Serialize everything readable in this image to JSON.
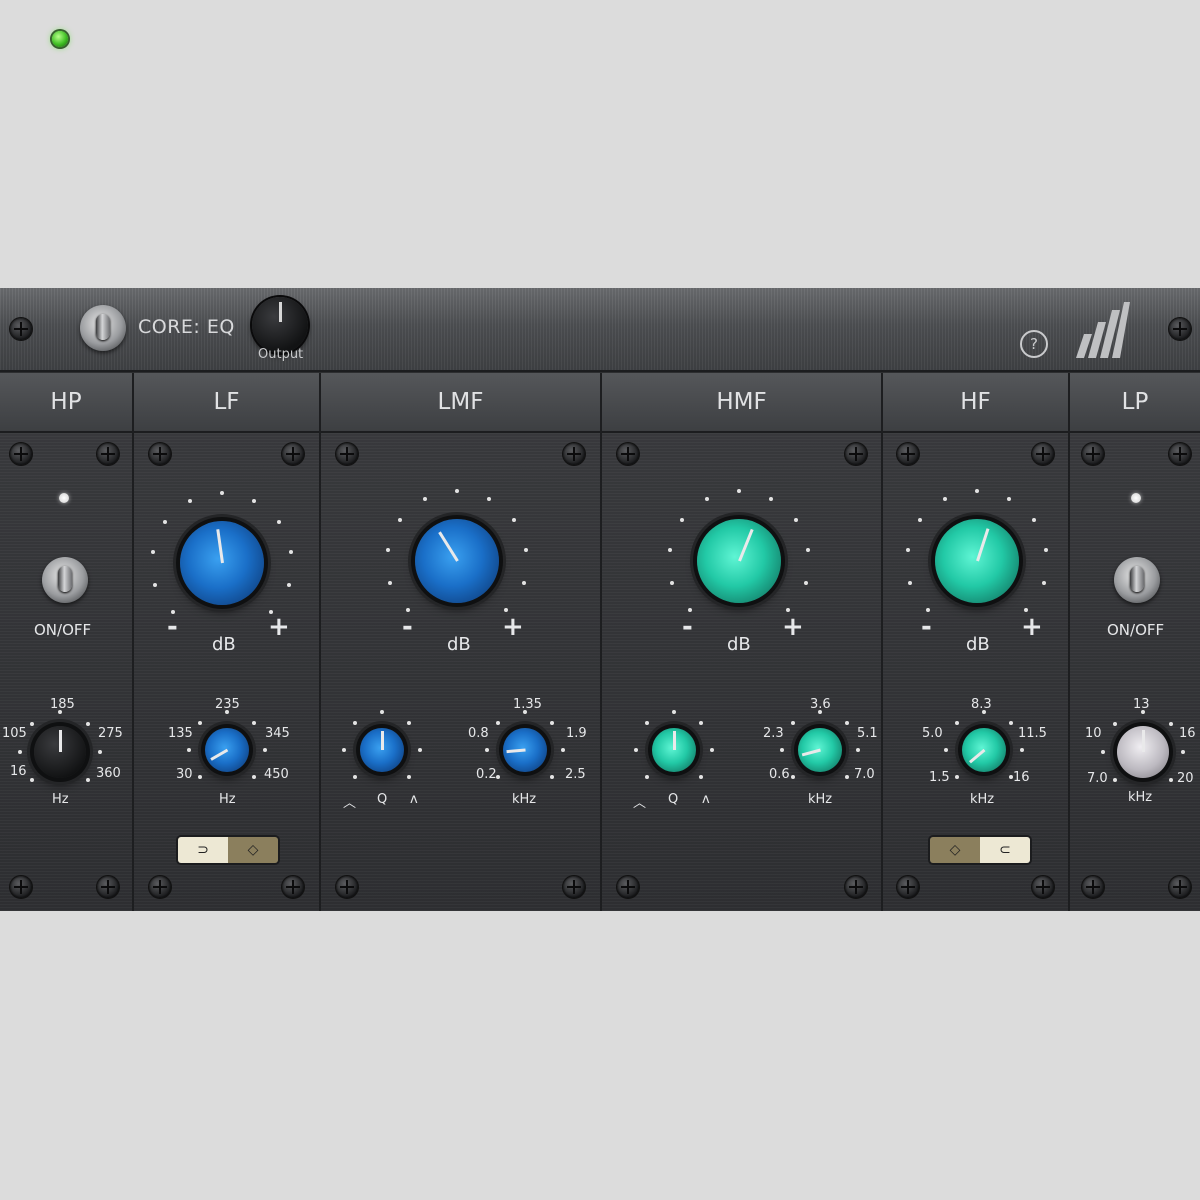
{
  "app": {
    "title": "CORE: EQ",
    "output_label": "Output",
    "help_icon": "help-icon",
    "logo_icon": "brand-logo"
  },
  "colors": {
    "blue": "#1a6fc8",
    "teal": "#22c9a6",
    "led_green": "#56e12e",
    "panel": "#2f3033"
  },
  "sections": {
    "hp": {
      "label": "HP",
      "switch_label": "ON/OFF",
      "freq": {
        "scale": [
          "185",
          "105",
          "275",
          "16",
          "360"
        ],
        "unit": "Hz"
      }
    },
    "lf": {
      "label": "LF",
      "gain": {
        "minus": "-",
        "plus": "+",
        "unit": "dB"
      },
      "freq": {
        "scale": [
          "235",
          "135",
          "345",
          "30",
          "450"
        ],
        "unit": "Hz"
      },
      "shape_switch": {
        "left": "shelf-icon",
        "right": "bell-icon",
        "selected": "right"
      }
    },
    "lmf": {
      "label": "LMF",
      "gain": {
        "minus": "-",
        "plus": "+",
        "unit": "dB"
      },
      "q": {
        "label": "Q",
        "left_icon": "q-wide-icon",
        "right_icon": "q-narrow-icon"
      },
      "freq": {
        "scale": [
          "1.35",
          "0.8",
          "1.9",
          "0.2",
          "2.5"
        ],
        "unit": "kHz"
      }
    },
    "hmf": {
      "label": "HMF",
      "gain": {
        "minus": "-",
        "plus": "+",
        "unit": "dB"
      },
      "q": {
        "label": "Q",
        "left_icon": "q-wide-icon",
        "right_icon": "q-narrow-icon"
      },
      "freq": {
        "scale": [
          "3.6",
          "2.3",
          "5.1",
          "0.6",
          "7.0"
        ],
        "unit": "kHz"
      }
    },
    "hf": {
      "label": "HF",
      "gain": {
        "minus": "-",
        "plus": "+",
        "unit": "dB"
      },
      "freq": {
        "scale": [
          "8.3",
          "5.0",
          "11.5",
          "1.5",
          "16"
        ],
        "unit": "kHz"
      },
      "shape_switch": {
        "left": "bell-icon",
        "right": "shelf-icon",
        "selected": "left"
      }
    },
    "lp": {
      "label": "LP",
      "switch_label": "ON/OFF",
      "freq": {
        "scale": [
          "13",
          "10",
          "16",
          "7.0",
          "20"
        ],
        "unit": "kHz"
      }
    }
  }
}
